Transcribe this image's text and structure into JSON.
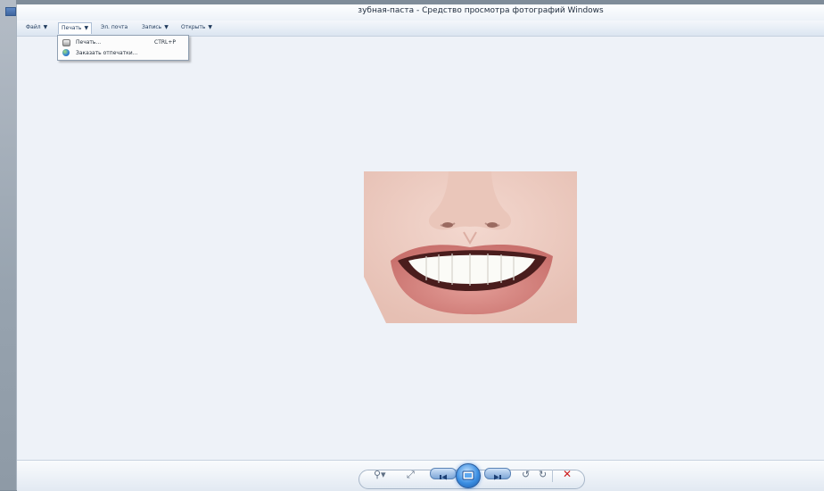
{
  "window": {
    "title": "зубная-паста - Средство просмотра фотографий Windows"
  },
  "menu": {
    "file": "Файл",
    "print": "Печать",
    "email": "Эл. почта",
    "burn": "Запись",
    "open": "Открыть",
    "caret": "▼"
  },
  "print_menu": {
    "print_label": "Печать...",
    "print_shortcut": "CTRL+P",
    "order_prints": "Заказать отпечатки..."
  },
  "icons": {
    "app": "photo-viewer-icon",
    "zoom": "magnifier-icon",
    "fit": "fit-window-icon",
    "previous": "previous-icon",
    "slideshow": "slideshow-icon",
    "next": "next-icon",
    "rotate_ccw": "rotate-left-icon",
    "rotate_cw": "rotate-right-icon",
    "delete": "delete-icon"
  },
  "glyphs": {
    "zoom": "⚲▾",
    "fit": "⤢",
    "rotate_ccw": "↺",
    "rotate_cw": "↻",
    "delete": "✕"
  },
  "colors": {
    "viewer_background": "#eef2f8",
    "accent_blue": "#3c8fe3",
    "delete_red": "#cc1d1d"
  }
}
